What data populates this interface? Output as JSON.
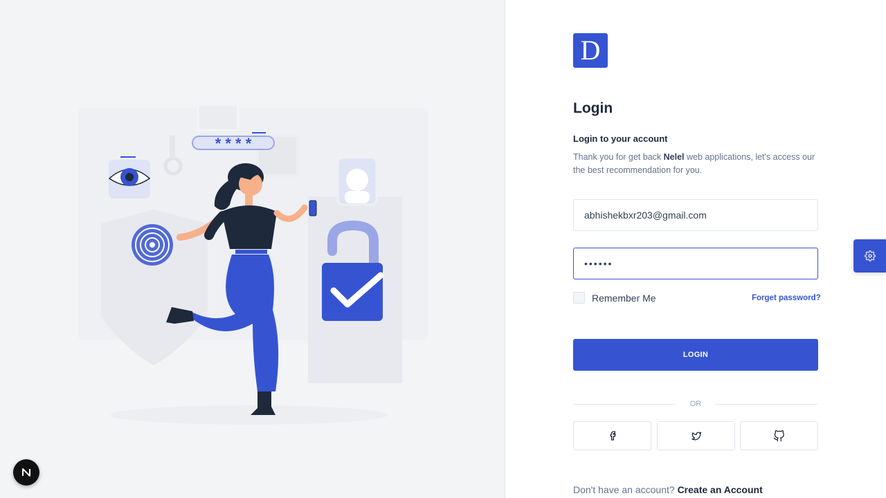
{
  "brand": {
    "logo_letter": "D",
    "accent": "#3654d1"
  },
  "login": {
    "title": "Login",
    "subtitle": "Login to your account",
    "description_prefix": "Thank you for get back ",
    "description_brand": "Nelel",
    "description_suffix": " web applications, let's access our the best recommendation for you.",
    "email_value": "abhishekbxr203@gmail.com",
    "password_masked": "••••••",
    "remember_label": "Remember Me",
    "forgot_label": "Forget password?",
    "login_button": "LOGIN",
    "or_label": "OR",
    "social": [
      "facebook-icon",
      "twitter-icon",
      "github-icon"
    ],
    "signup_prompt": "Don't have an account?",
    "signup_link": "Create an Account"
  },
  "illustration": {
    "password_stars": "* * * *"
  },
  "floating": {
    "settings_icon": "gear-icon",
    "dev_badge": "N"
  }
}
